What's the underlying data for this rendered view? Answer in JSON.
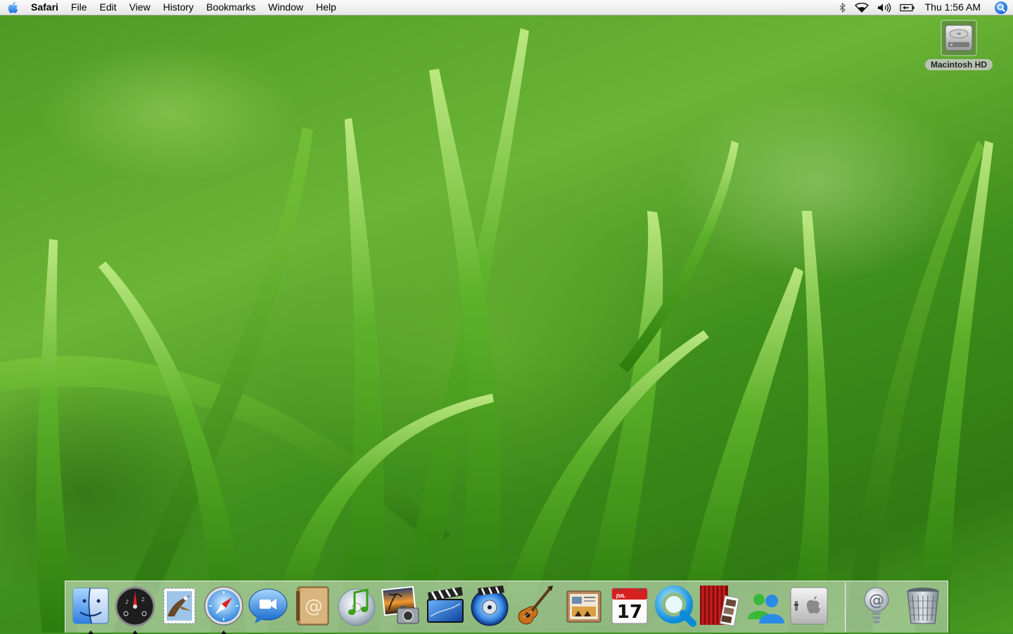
{
  "menubar": {
    "apple_icon": "apple-icon",
    "app_name": "Safari",
    "menus": [
      "File",
      "Edit",
      "View",
      "History",
      "Bookmarks",
      "Window",
      "Help"
    ],
    "status_icons": [
      "bluetooth-icon",
      "wifi-icon",
      "volume-icon",
      "battery-icon"
    ],
    "clock": "Thu 1:56 AM",
    "spotlight_icon": "spotlight-icon"
  },
  "desktop": {
    "icons": [
      {
        "label": "Macintosh HD",
        "icon": "hard-drive-icon"
      }
    ]
  },
  "dock": {
    "items": [
      {
        "icon": "finder-icon",
        "running": true
      },
      {
        "icon": "dashboard-icon",
        "running": true
      },
      {
        "icon": "mail-icon",
        "running": false
      },
      {
        "icon": "safari-icon",
        "running": true
      },
      {
        "icon": "ichat-icon",
        "running": false
      },
      {
        "icon": "address-book-icon",
        "running": false
      },
      {
        "icon": "itunes-icon",
        "running": false
      },
      {
        "icon": "iphoto-icon",
        "running": false
      },
      {
        "icon": "imovie-icon",
        "running": false
      },
      {
        "icon": "idvd-icon",
        "running": false
      },
      {
        "icon": "garageband-icon",
        "running": false
      },
      {
        "icon": "iweb-icon",
        "running": false
      },
      {
        "icon": "ical-icon",
        "running": false
      },
      {
        "icon": "quicktime-icon",
        "running": false
      },
      {
        "icon": "photo-booth-icon",
        "running": false
      },
      {
        "icon": "msn-messenger-icon",
        "running": false
      },
      {
        "icon": "system-preferences-icon",
        "running": false
      },
      {
        "icon": "downloads-stack-icon",
        "running": false
      },
      {
        "icon": "trash-icon",
        "running": false
      }
    ],
    "ical_month": "JUL",
    "ical_day": "17"
  }
}
